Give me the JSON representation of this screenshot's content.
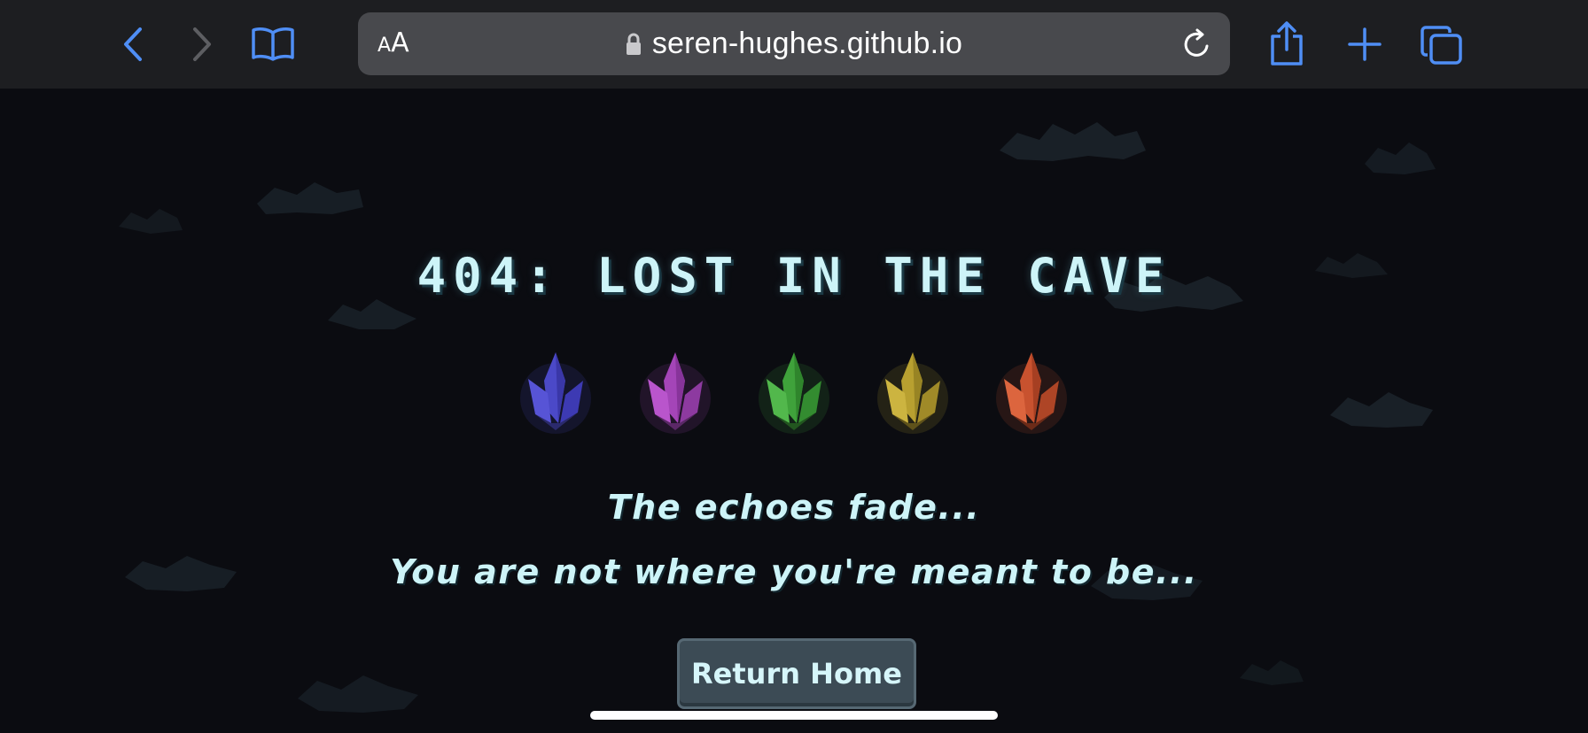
{
  "browser": {
    "text_size_label_small": "A",
    "text_size_label_large": "A",
    "url": "seren-hughes.github.io",
    "icons": {
      "back": "chevron-left-icon",
      "forward": "chevron-right-icon",
      "bookmarks": "open-book-icon",
      "lock": "lock-icon",
      "reload": "reload-icon",
      "share": "share-icon",
      "new_tab": "plus-icon",
      "tabs": "tabs-overview-icon"
    },
    "colors": {
      "toolbar_bg": "#1d1e21",
      "urlbar_bg": "#48494d",
      "accent": "#4f8ef5"
    }
  },
  "page": {
    "title": "404: LOST IN THE CAVE",
    "message_line1": "The echoes fade...",
    "message_line2": "You are not where you're meant to be...",
    "button_label": "Return Home",
    "crystals": [
      {
        "name": "blue-crystal-icon",
        "color": "#4b49c8"
      },
      {
        "name": "purple-crystal-icon",
        "color": "#a445b8"
      },
      {
        "name": "green-crystal-icon",
        "color": "#3fa23b"
      },
      {
        "name": "yellow-crystal-icon",
        "color": "#b8a030"
      },
      {
        "name": "red-crystal-icon",
        "color": "#c8522f"
      }
    ],
    "colors": {
      "background": "#0b0c11",
      "text": "#cdf4f8",
      "button_bg": "#3c4b55"
    }
  }
}
